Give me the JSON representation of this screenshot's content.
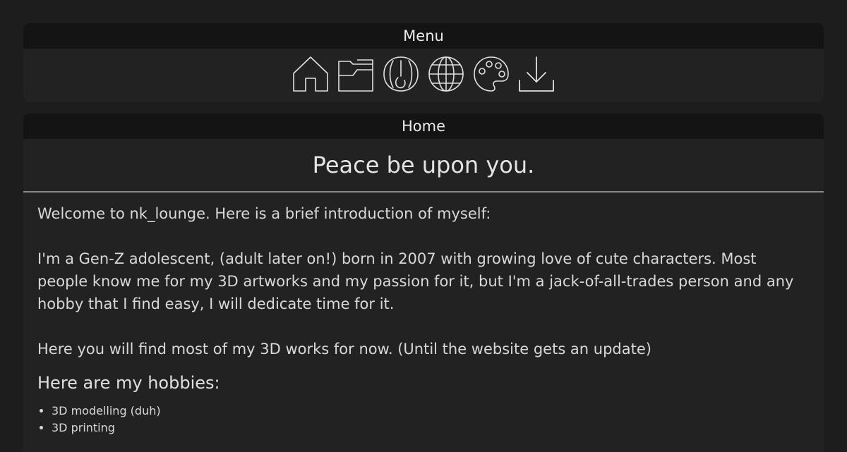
{
  "menu": {
    "title": "Menu",
    "icons": [
      "home-icon",
      "folder-icon",
      "3d-icon",
      "globe-icon",
      "palette-icon",
      "download-icon"
    ]
  },
  "home": {
    "title": "Home",
    "greeting": "Peace be upon you.",
    "intro": "Welcome to nk_lounge. Here is a brief introduction of myself:",
    "about": "I'm a Gen-Z adolescent, (adult later on!) born in 2007 with growing love of cute characters. Most people know me for my 3D artworks and my passion for it, but I'm a jack-of-all-trades person and any hobby that I find easy, I will dedicate time for it.",
    "works_note": "Here you will find most of my 3D works for now. (Until the website gets an update)",
    "hobbies_title": "Here are my hobbies:",
    "hobbies": [
      "3D modelling (duh)",
      "3D printing"
    ]
  },
  "colors": {
    "background": "#1d1d1d",
    "panel": "#222222",
    "header": "#141414",
    "text": "#dcdcdc"
  }
}
